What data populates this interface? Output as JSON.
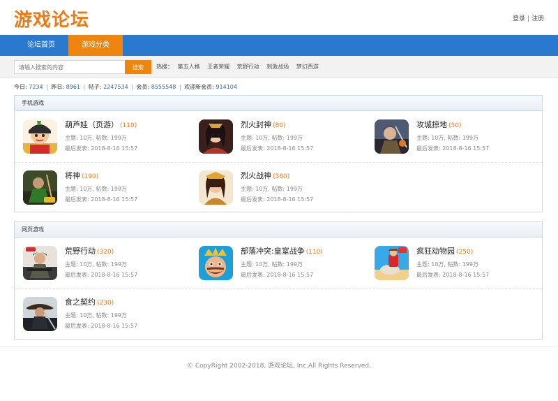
{
  "header": {
    "logo": "游戏论坛",
    "login": "登录",
    "sep": "|",
    "register": "注册"
  },
  "nav": {
    "tabs": [
      {
        "label": "论坛首页"
      },
      {
        "label": "游戏分类"
      }
    ],
    "active_color": "#ee850f",
    "bar_color": "#2a79cf"
  },
  "search": {
    "placeholder": "请输入搜索的内容",
    "button": "搜索",
    "hot_label": "热搜：",
    "hot_items": [
      "第五人格",
      "王者荣耀",
      "荒野行动",
      "刺激战场",
      "梦幻西游"
    ]
  },
  "stats": {
    "today_label": "今日:",
    "today": "7234",
    "yesterday_label": "昨日:",
    "yesterday": "8961",
    "posts_label": "帖子:",
    "posts": "2247534",
    "members_label": "会员:",
    "members": "8555548",
    "welcome_label": "欢迎新会员:",
    "welcome": "914104",
    "sep": "|"
  },
  "sections": [
    {
      "title": "手机游戏",
      "games": [
        {
          "name": "葫芦娃（页游）",
          "count": "(110)",
          "meta": "主题: 10万, 帖数: 199万",
          "last": "最后发表: 2018-8-16 15:57",
          "icon": "calabash-icon"
        },
        {
          "name": "烈火封神",
          "count": "(80)",
          "meta": "主题: 10万, 帖数: 199万",
          "last": "最后发表: 2018-8-16 15:57",
          "icon": "warrior-girl-icon"
        },
        {
          "name": "攻城掠地",
          "count": "(50)",
          "meta": "主题: 10万, 帖数: 199万",
          "last": "最后发表: 2018-8-16 15:57",
          "icon": "general-icon"
        },
        {
          "name": "将神",
          "count": "(190)",
          "meta": "主题: 10万, 帖数: 199万",
          "last": "最后发表: 2018-8-16 15:57",
          "icon": "green-warrior-icon"
        },
        {
          "name": "烈火战神",
          "count": "(580)",
          "meta": "主题: 10万, 帖数: 199万",
          "last": "最后发表: 2018-8-16 15:57",
          "icon": "goddess-icon"
        }
      ]
    },
    {
      "title": "网页游戏",
      "games": [
        {
          "name": "荒野行动",
          "count": "(320)",
          "meta": "主题: 10万, 帖数: 199万",
          "last": "最后发表: 2018-8-16 15:57",
          "icon": "soldier-icon"
        },
        {
          "name": "部落冲突:皇室战争",
          "count": "(110)",
          "meta": "主题: 10万, 帖数: 199万",
          "last": "最后发表: 2018-8-16 15:57",
          "icon": "clash-royale-icon"
        },
        {
          "name": "疯狂动物园",
          "count": "(250)",
          "meta": "主题: 10万, 帖数: 199万",
          "last": "最后发表: 2018-8-16 15:57",
          "icon": "rodeo-stampede-icon"
        },
        {
          "name": "食之契约",
          "count": "(230)",
          "meta": "主题: 10万, 帖数: 199万",
          "last": "最后发表: 2018-8-16 15:57",
          "icon": "swordsman-icon"
        }
      ]
    }
  ],
  "footer": "© CopyRight 2002-2018, 游戏论坛, Inc.All Rights Reserved."
}
